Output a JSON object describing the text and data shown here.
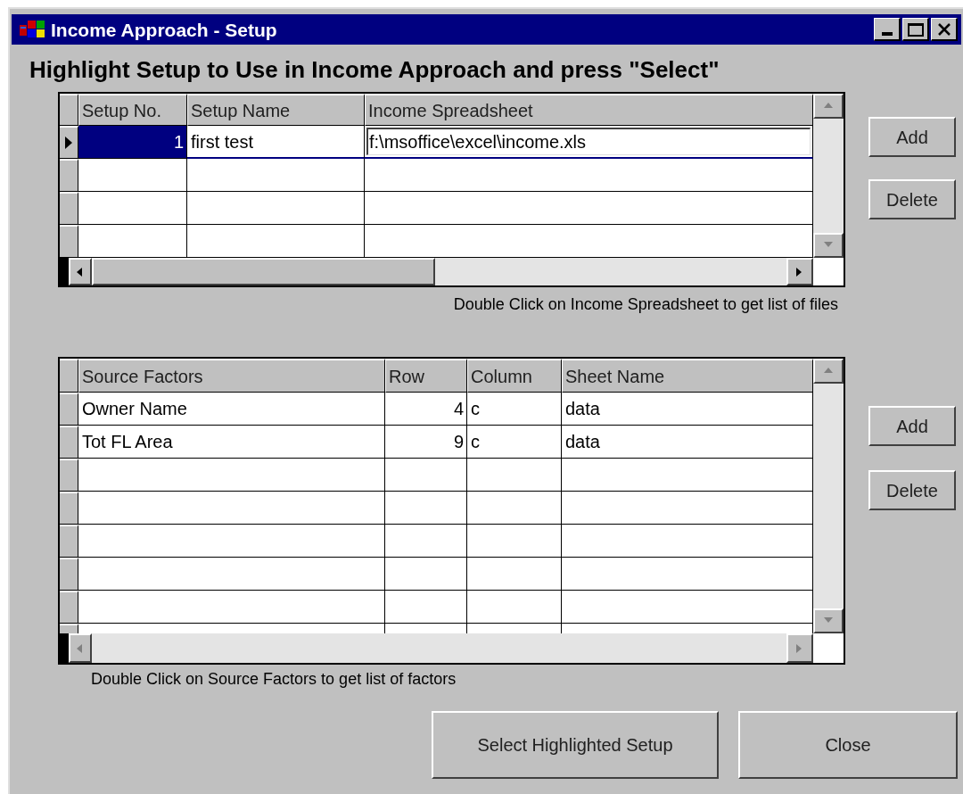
{
  "window": {
    "title": "Income Approach - Setup"
  },
  "heading": "Highlight Setup to Use in Income Approach and press \"Select\"",
  "setups": {
    "columns": [
      "Setup No.",
      "Setup Name",
      "Income Spreadsheet"
    ],
    "rows": [
      {
        "cells": [
          "1",
          "first test",
          "f:\\msoffice\\excel\\income.xls"
        ],
        "selected": true
      }
    ],
    "hint": "Double Click on Income Spreadsheet to get list of files"
  },
  "setup_buttons": [
    "Add",
    "Delete"
  ],
  "factors": {
    "columns": [
      "Source Factors",
      "Row",
      "Column",
      "Sheet Name"
    ],
    "rows": [
      {
        "cells": [
          "Owner Name",
          "4",
          "c",
          "data"
        ]
      },
      {
        "cells": [
          "Tot FL Area",
          "9",
          "c",
          "data"
        ]
      }
    ],
    "hint": "Double Click on Source Factors to get list of factors"
  },
  "factor_buttons": [
    "Add",
    "Delete"
  ],
  "buttons": [
    "Select Highlighted Setup",
    "Close"
  ]
}
